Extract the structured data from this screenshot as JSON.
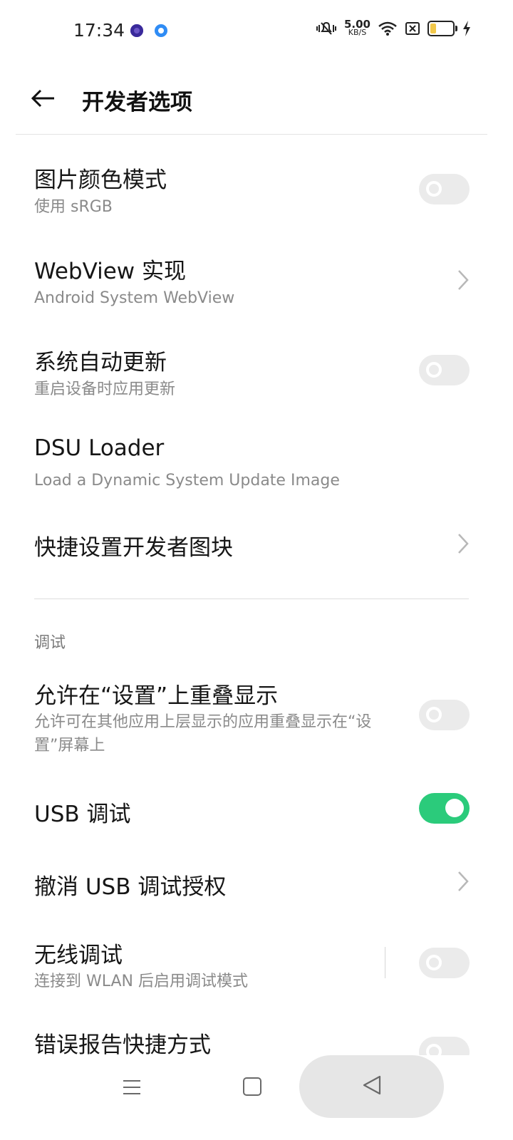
{
  "status_bar": {
    "time": "17:34",
    "net_speed_value": "5.00",
    "net_speed_unit": "KB/S",
    "icons": [
      "silent-bell-icon",
      "wifi-icon",
      "sim-none-icon",
      "battery-icon",
      "charging-icon"
    ]
  },
  "header": {
    "title": "开发者选项",
    "back_icon": "back-arrow-icon"
  },
  "settings": {
    "color_mode": {
      "title": "图片颜色模式",
      "summary": "使用 sRGB",
      "enabled": false
    },
    "webview": {
      "title": "WebView 实现",
      "summary": "Android System WebView"
    },
    "auto_update": {
      "title": "系统自动更新",
      "summary": "重启设备时应用更新",
      "enabled": false
    },
    "dsu_loader": {
      "title": "DSU Loader",
      "summary": "Load a Dynamic System Update Image"
    },
    "quick_tiles": {
      "title": "快捷设置开发者图块"
    }
  },
  "debug_section": {
    "header": "调试",
    "overlay": {
      "title": "允许在“设置”上重叠显示",
      "summary": "允许可在其他应用上层显示的应用重叠显示在“设置”屏幕上",
      "enabled": false
    },
    "usb_debug": {
      "title": "USB 调试",
      "enabled": true
    },
    "revoke_usb": {
      "title": "撤消 USB 调试授权"
    },
    "wireless_debug": {
      "title": "无线调试",
      "summary": "连接到 WLAN 后启用调试模式",
      "enabled": false
    },
    "bugreport": {
      "title": "错误报告快捷方式",
      "enabled": false
    }
  },
  "colors": {
    "toggle_on": "#2bcb7b",
    "toggle_off": "#ebebeb",
    "summary_text": "#8a8a8a"
  },
  "navbar": {
    "icons": [
      "menu-icon",
      "home-icon",
      "back-triangle-icon"
    ]
  }
}
